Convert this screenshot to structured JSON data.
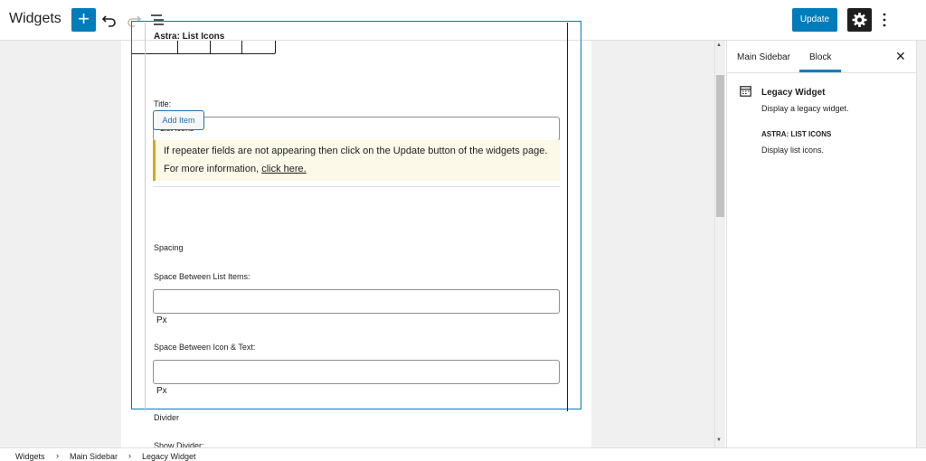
{
  "header": {
    "title": "Widgets",
    "add_label": "+",
    "update_label": "Update"
  },
  "block": {
    "widget_title": "Astra: List Icons",
    "title_label": "Title:",
    "title_value": "List icons",
    "add_item_label": "Add Item",
    "notice_text": "If repeater fields are not appearing then click on the Update button of the widgets page. For more information, ",
    "notice_link": "click here.",
    "spacing_heading": "Spacing",
    "space_items_label": "Space Between List Items:",
    "space_items_unit": "Px",
    "space_icon_label": "Space Between Icon & Text:",
    "space_icon_unit": "Px",
    "divider_heading": "Divider",
    "show_divider_label": "Show Divider:"
  },
  "sidebar": {
    "tabs": [
      {
        "label": "Main Sidebar"
      },
      {
        "label": "Block"
      }
    ],
    "close_label": "✕",
    "block_name": "Legacy Widget",
    "block_desc": "Display a legacy widget.",
    "widget_type": "ASTRA: LIST ICONS",
    "widget_desc": "Display list icons."
  },
  "breadcrumb": [
    "Widgets",
    "Main Sidebar",
    "Legacy Widget"
  ],
  "colors": {
    "accent": "#007cba",
    "notice_border": "#dba617",
    "notice_bg": "#fcf9e8"
  }
}
